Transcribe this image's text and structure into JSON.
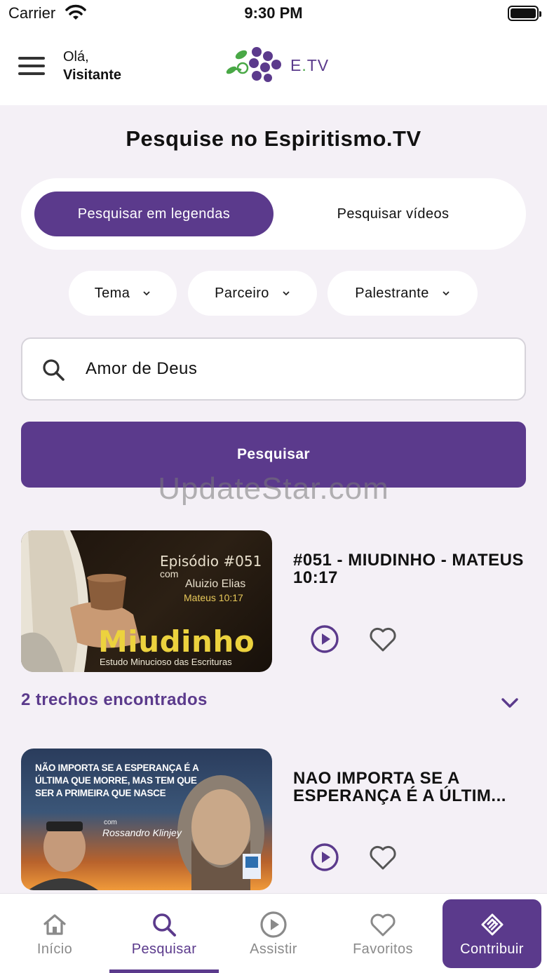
{
  "status_bar": {
    "carrier": "Carrier",
    "time": "9:30 PM"
  },
  "header": {
    "greeting_line1": "Olá,",
    "greeting_line2": "Visitante",
    "logo_text_prefix": "E",
    "logo_text_dot": ".",
    "logo_text_suffix": "TV"
  },
  "page_title": "Pesquise no Espiritismo.TV",
  "segments": {
    "active": "Pesquisar em legendas",
    "inactive": "Pesquisar vídeos"
  },
  "filters": {
    "tema": "Tema",
    "parceiro": "Parceiro",
    "palestrante": "Palestrante"
  },
  "search": {
    "value": "Amor de Deus"
  },
  "search_button": "Pesquisar",
  "watermark": "UpdateStar.com",
  "results": [
    {
      "title": "#051 - MIUDINHO - MATEUS 10:17",
      "thumb": {
        "episode": "Episódio #051",
        "com": "com",
        "speaker": "Aluizio Elias",
        "ref": "Mateus 10:17",
        "brand": "Miudinho",
        "subtitle": "Estudo Minucioso das Escrituras"
      }
    },
    {
      "title": "NAO IMPORTA SE A ESPERANÇA É A ÚLTIM...",
      "thumb": {
        "line1": "NÃO IMPORTA SE A ESPERANÇA É A",
        "line2": "ÚLTIMA QUE MORRE, MAS TEM QUE",
        "line3": "SER A PRIMEIRA QUE NASCE",
        "com": "com",
        "speaker": "Rossandro Klinjey"
      }
    }
  ],
  "trechos_label": "2 trechos encontrados",
  "tabs": {
    "inicio": "Início",
    "pesquisar": "Pesquisar",
    "assistir": "Assistir",
    "favoritos": "Favoritos",
    "contribuir": "Contribuir"
  },
  "colors": {
    "brand_purple": "#5b3a8c",
    "brand_green": "#49a846",
    "background": "#f4f0f6"
  }
}
